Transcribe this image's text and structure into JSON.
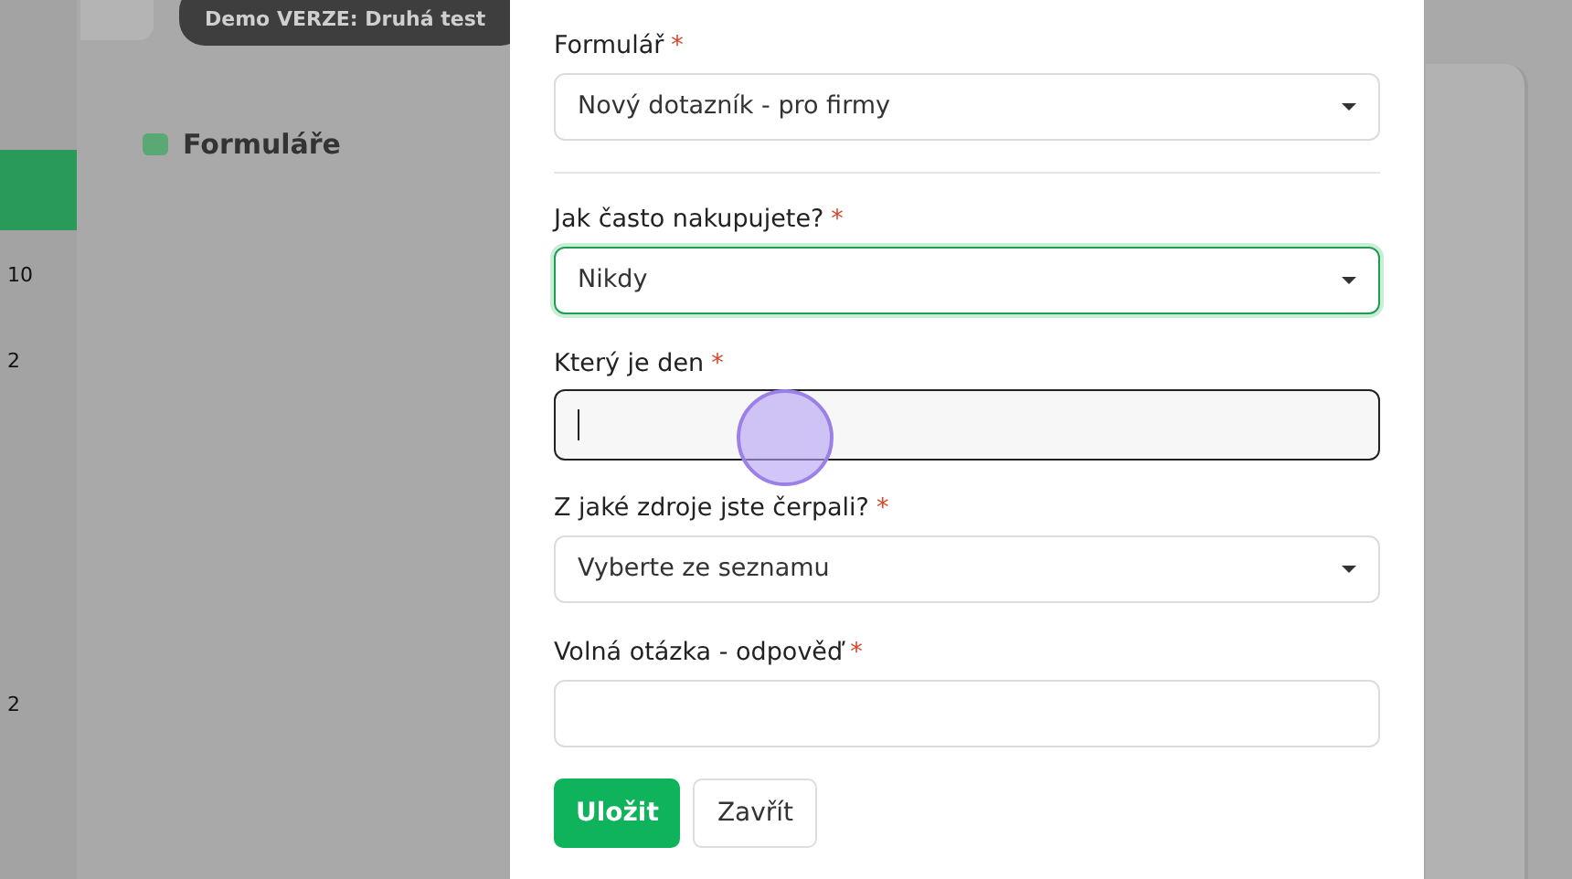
{
  "background": {
    "banner": "Demo VERZE: Druhá test",
    "heading": "Formuláře",
    "sidebar_counts": [
      "10",
      "2",
      "2"
    ]
  },
  "form": {
    "fields": [
      {
        "kind": "select",
        "label": "Formulář",
        "required_mark": "*",
        "value": "Nový dotazník - pro firmy",
        "focused": false
      },
      {
        "kind": "divider"
      },
      {
        "kind": "select",
        "label": "Jak často nakupujete?",
        "required_mark": "*",
        "value": "Nikdy",
        "focused": true
      },
      {
        "kind": "text",
        "label": "Který je den",
        "required_mark": "*",
        "focused": true
      },
      {
        "kind": "select",
        "label": "Z jaké zdroje jste čerpali?",
        "required_mark": "*",
        "value": "Vyberte ze seznamu",
        "focused": false
      },
      {
        "kind": "text",
        "label": "Volná otázka - odpověď",
        "required_mark": "*",
        "focused": false
      }
    ],
    "buttons": [
      {
        "label": "Uložit",
        "kind": "primary"
      },
      {
        "label": "Zavřít",
        "kind": "secondary"
      }
    ]
  }
}
